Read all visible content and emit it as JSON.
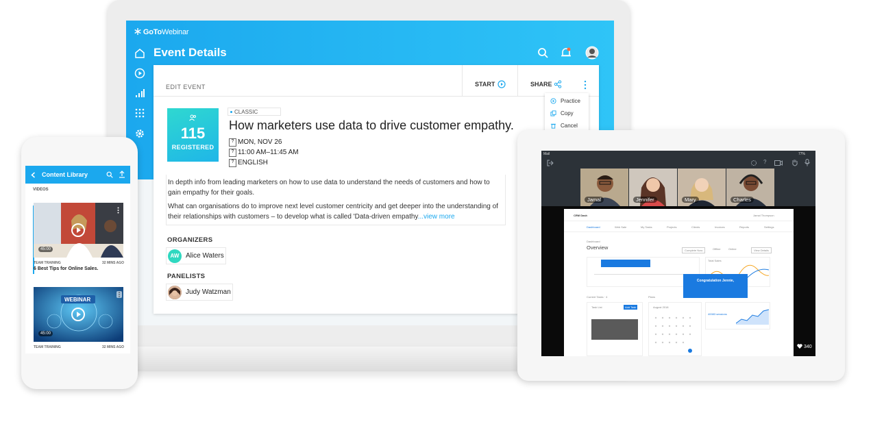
{
  "laptop": {
    "brand_bold": "GoTo",
    "brand_light": "Webinar",
    "title": "Event Details",
    "edit_label": "EDIT EVENT",
    "start_label": "START",
    "share_label": "SHARE",
    "share_menu": [
      "Practice",
      "Copy",
      "Cancel"
    ],
    "event": {
      "registered_count": "115",
      "registered_label": "REGISTERED",
      "badge": "CLASSIC",
      "title": "How marketers use data to drive customer empathy.",
      "date": "MON, NOV 26",
      "time": "11:00 AM–11:45 AM",
      "language": "ENGLISH",
      "description_1": "In depth info from leading marketers on how to use data to understand the needs of customers and how to gain empathy for their goals.",
      "description_2": "What can organisations do to improve next level customer centricity and get deeper into the understanding of their relationships with customers – to develop what is called 'Data-driven empathy",
      "view_more": "...view more"
    },
    "organizers_label": "ORGANIZERS",
    "organizer": {
      "initials": "AW",
      "name": "Alice Waters"
    },
    "panelists_label": "PANELISTS",
    "panelist": {
      "name": "Judy Watzman"
    }
  },
  "phone": {
    "title": "Content Library",
    "section": "VIDEOS",
    "items": [
      {
        "duration": "45:00",
        "category": "TEAM TRAINING",
        "ago": "32 MINS AGO",
        "title": "6 Best Tips for Online Sales."
      },
      {
        "duration": "45:00",
        "category": "TEAM TRAINING",
        "ago": "32 MINS AGO",
        "title": "",
        "banner": "WEBINAR"
      }
    ]
  },
  "tablet": {
    "status_left": "Mail",
    "status_right": "77%",
    "attendees": [
      "Jamal",
      "Jennifer",
      "Mary",
      "Charles"
    ],
    "likes": "340",
    "shared": {
      "app_name": "CRM Dash",
      "user": "Jamal Thompson",
      "tabs": [
        "Dashboard",
        "Web Sale",
        "My Tasks",
        "Projects",
        "Clients",
        "Invoices",
        "Reports",
        "Settings"
      ],
      "heading_small": "Dashboard",
      "heading": "Overview",
      "btn_complete": "Complete Now",
      "btn_view": "View Details",
      "legend": [
        "Offline",
        "Online"
      ],
      "total_sales": "Total Sales",
      "current_tasks": "Current Tasks · 4",
      "plans": "Plans",
      "user_visits": "User Visits",
      "task_list": "Task List",
      "add_task": "Add Task",
      "calendar_month": "August 2018",
      "sessions": "40083 sessions",
      "congrats": "Congratulation Jennie,"
    }
  },
  "colors": {
    "brand_blue": "#1ba8ee",
    "teal": "#2fd8d0"
  }
}
